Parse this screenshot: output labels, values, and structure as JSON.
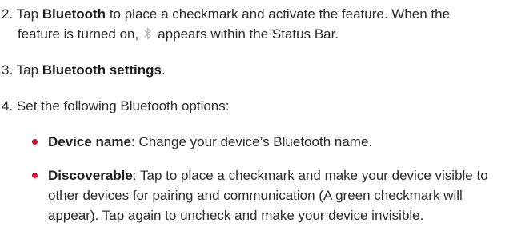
{
  "steps": [
    {
      "number": "2.",
      "bold_1": "Bluetooth",
      "text_1": " to place a checkmark and activate the feature. When the",
      "line_2_pre": "feature is turned on,",
      "line_2_post": "appears within the Status Bar.",
      "lead": "Tap",
      "icon": "bluetooth-icon"
    },
    {
      "number": "3.",
      "lead": "Tap",
      "bold": "Bluetooth settings",
      "tail": "."
    },
    {
      "number": "4.",
      "text": "Set the following Bluetooth options:"
    }
  ],
  "bullets": [
    {
      "term": "Device name",
      "sep": ":",
      "text": " Change your device’s Bluetooth name."
    },
    {
      "term": "Discoverable",
      "sep": ":",
      "line_1": " Tap to place a checkmark and make your device visible to",
      "line_2": "other devices for pairing and communication (A green checkmark will",
      "line_3": "appear). Tap again to uncheck and make your device invisible."
    }
  ],
  "colors": {
    "bullet": "#c8102e",
    "text": "#2b2b2b",
    "icon": "#b5b5b5"
  }
}
